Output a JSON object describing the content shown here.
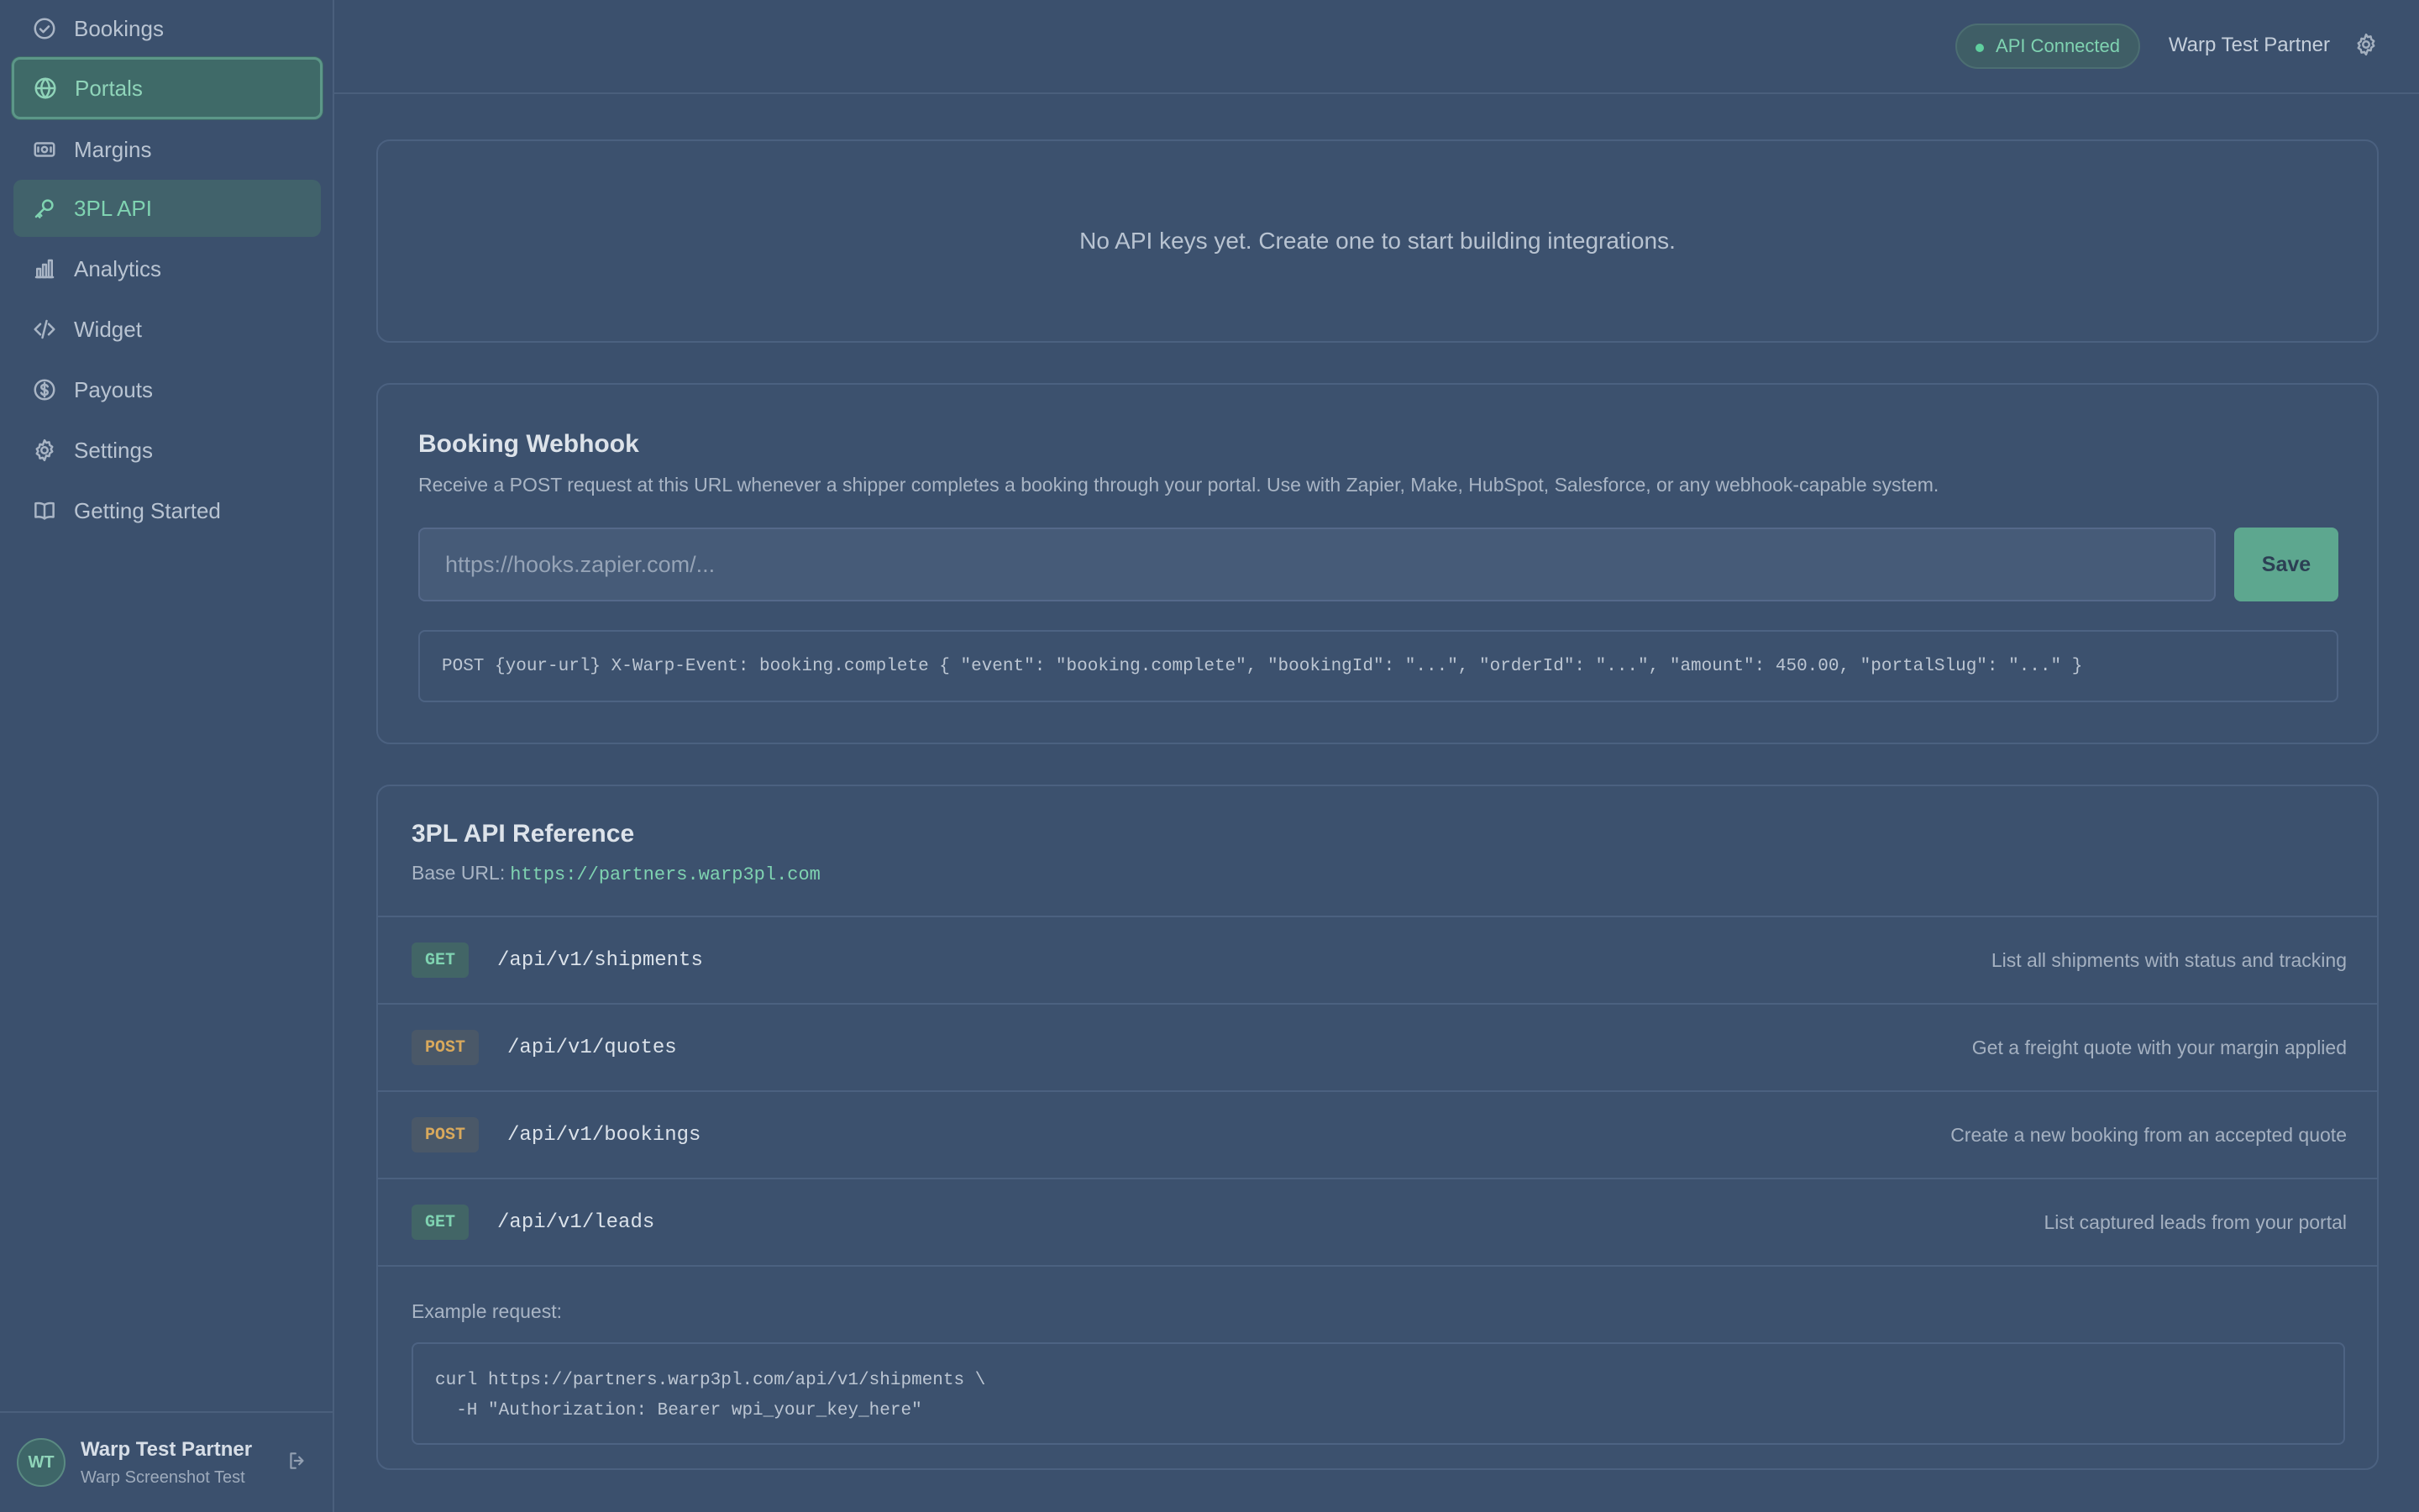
{
  "sidebar": {
    "items": [
      {
        "label": "Bookings",
        "icon": "check-circle-icon"
      },
      {
        "label": "Portals",
        "icon": "globe-icon"
      },
      {
        "label": "Margins",
        "icon": "banknote-icon"
      },
      {
        "label": "3PL API",
        "icon": "key-icon"
      },
      {
        "label": "Analytics",
        "icon": "bar-chart-icon"
      },
      {
        "label": "Widget",
        "icon": "code-icon"
      },
      {
        "label": "Payouts",
        "icon": "dollar-circle-icon"
      },
      {
        "label": "Settings",
        "icon": "gear-icon"
      },
      {
        "label": "Getting Started",
        "icon": "book-icon"
      }
    ],
    "user": {
      "initials": "WT",
      "name": "Warp Test Partner",
      "subtitle": "Warp Screenshot Test"
    }
  },
  "header": {
    "status": "API Connected",
    "partner": "Warp Test Partner"
  },
  "api_keys": {
    "empty_message": "No API keys yet. Create one to start building integrations."
  },
  "webhook": {
    "title": "Booking Webhook",
    "description": "Receive a POST request at this URL whenever a shipper completes a booking through your portal. Use with Zapier, Make, HubSpot, Salesforce, or any webhook-capable system.",
    "placeholder": "https://hooks.zapier.com/...",
    "value": "",
    "save_label": "Save",
    "payload_example": "POST {your-url} X-Warp-Event: booking.complete { \"event\": \"booking.complete\", \"bookingId\": \"...\", \"orderId\": \"...\", \"amount\": 450.00, \"portalSlug\": \"...\" }"
  },
  "reference": {
    "title": "3PL API Reference",
    "base_label": "Base URL:",
    "base_url": "https://partners.warp3pl.com",
    "endpoints": [
      {
        "method": "GET",
        "path": "/api/v1/shipments",
        "description": "List all shipments with status and tracking"
      },
      {
        "method": "POST",
        "path": "/api/v1/quotes",
        "description": "Get a freight quote with your margin applied"
      },
      {
        "method": "POST",
        "path": "/api/v1/bookings",
        "description": "Create a new booking from an accepted quote"
      },
      {
        "method": "GET",
        "path": "/api/v1/leads",
        "description": "List captured leads from your portal"
      }
    ],
    "example_label": "Example request:",
    "example_code": "curl https://partners.warp3pl.com/api/v1/shipments \\\n  -H \"Authorization: Bearer wpi_your_key_here\""
  },
  "colors": {
    "background": "#3b506d",
    "accent": "#7fd3b1",
    "post_method": "#d9a95c",
    "save_button": "#5da78f"
  }
}
